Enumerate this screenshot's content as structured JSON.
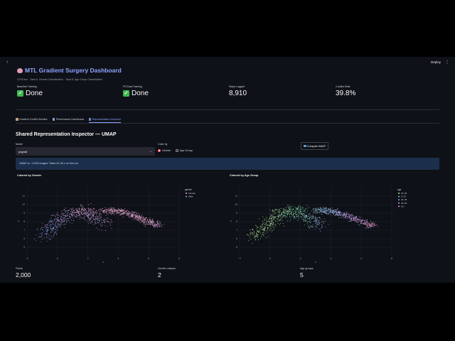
{
  "topbar": {
    "sidebar_icon": "chevron-right-icon",
    "deploy": "Deploy",
    "menu_icon": "more-vertical-icon"
  },
  "header": {
    "title": "MTL Gradient Surgery Dashboard",
    "subtitle": "UTKFace · Task A: Gender Classification · Task B: Age Group Classification"
  },
  "metrics": [
    {
      "label": "Baseline Training",
      "value": "Done",
      "icon": "check-icon"
    },
    {
      "label": "PCGrad Training",
      "value": "Done",
      "icon": "check-icon"
    },
    {
      "label": "Steps Logged",
      "value": "8,910"
    },
    {
      "label": "Conflict Rate",
      "value": "39.8%"
    }
  ],
  "tabs": [
    {
      "label": "Gradient Conflict Monitor",
      "active": false
    },
    {
      "label": "Performance Dashboard",
      "active": false
    },
    {
      "label": "Representation Inspector",
      "active": true
    }
  ],
  "section_title": "Shared Representation Inspector — UMAP",
  "model": {
    "label": "Model",
    "value": "pcgrad"
  },
  "color_by": {
    "label": "Color by",
    "options": [
      {
        "label": "Gender",
        "selected": true
      },
      {
        "label": "Age Group",
        "selected": false
      }
    ]
  },
  "compute_button": "Compute UMAP",
  "info_text": "UMAP on ~2,000 images. Takes 30–90 s on first run.",
  "accent_color": "#8fa2ff",
  "chart_data": [
    {
      "type": "scatter",
      "title": "Colored by Gender",
      "xlabel": "x",
      "ylabel": "y",
      "xlim": [
        -2,
        8
      ],
      "ylim": [
        4,
        12
      ],
      "x_ticks": [
        "−2",
        "0",
        "2",
        "4",
        "6",
        "8"
      ],
      "y_ticks": [
        "5",
        "6",
        "7",
        "8",
        "9",
        "10",
        "11"
      ],
      "legend_title": "gender",
      "legend_position": "top-right",
      "series": [
        {
          "name": "Female",
          "color": "#f5a3c7",
          "points": 1000
        },
        {
          "name": "Male",
          "color": "#8c9cf5",
          "points": 1000
        }
      ]
    },
    {
      "type": "scatter",
      "title": "Colored by Age Group",
      "xlabel": "x",
      "ylabel": "y",
      "xlim": [
        -2,
        8
      ],
      "ylim": [
        4,
        12
      ],
      "x_ticks": [
        "−2",
        "0",
        "2",
        "4",
        "6",
        "8"
      ],
      "y_ticks": [
        "5",
        "6",
        "7",
        "8",
        "9",
        "10",
        "11"
      ],
      "legend_title": "age",
      "legend_position": "top-right",
      "series": [
        {
          "name": "20–30",
          "color": "#b6e39a"
        },
        {
          "name": "0–19",
          "color": "#7fd4a0"
        },
        {
          "name": "31–45",
          "color": "#8fb6f0"
        },
        {
          "name": "46–60",
          "color": "#c9a0e8"
        },
        {
          "name": "61+",
          "color": "#f0a0d0"
        }
      ]
    }
  ],
  "bottom_metrics": [
    {
      "label": "Points",
      "value": "2,000"
    },
    {
      "label": "Gender classes",
      "value": "2"
    },
    {
      "label": "Age groups",
      "value": "5"
    }
  ]
}
